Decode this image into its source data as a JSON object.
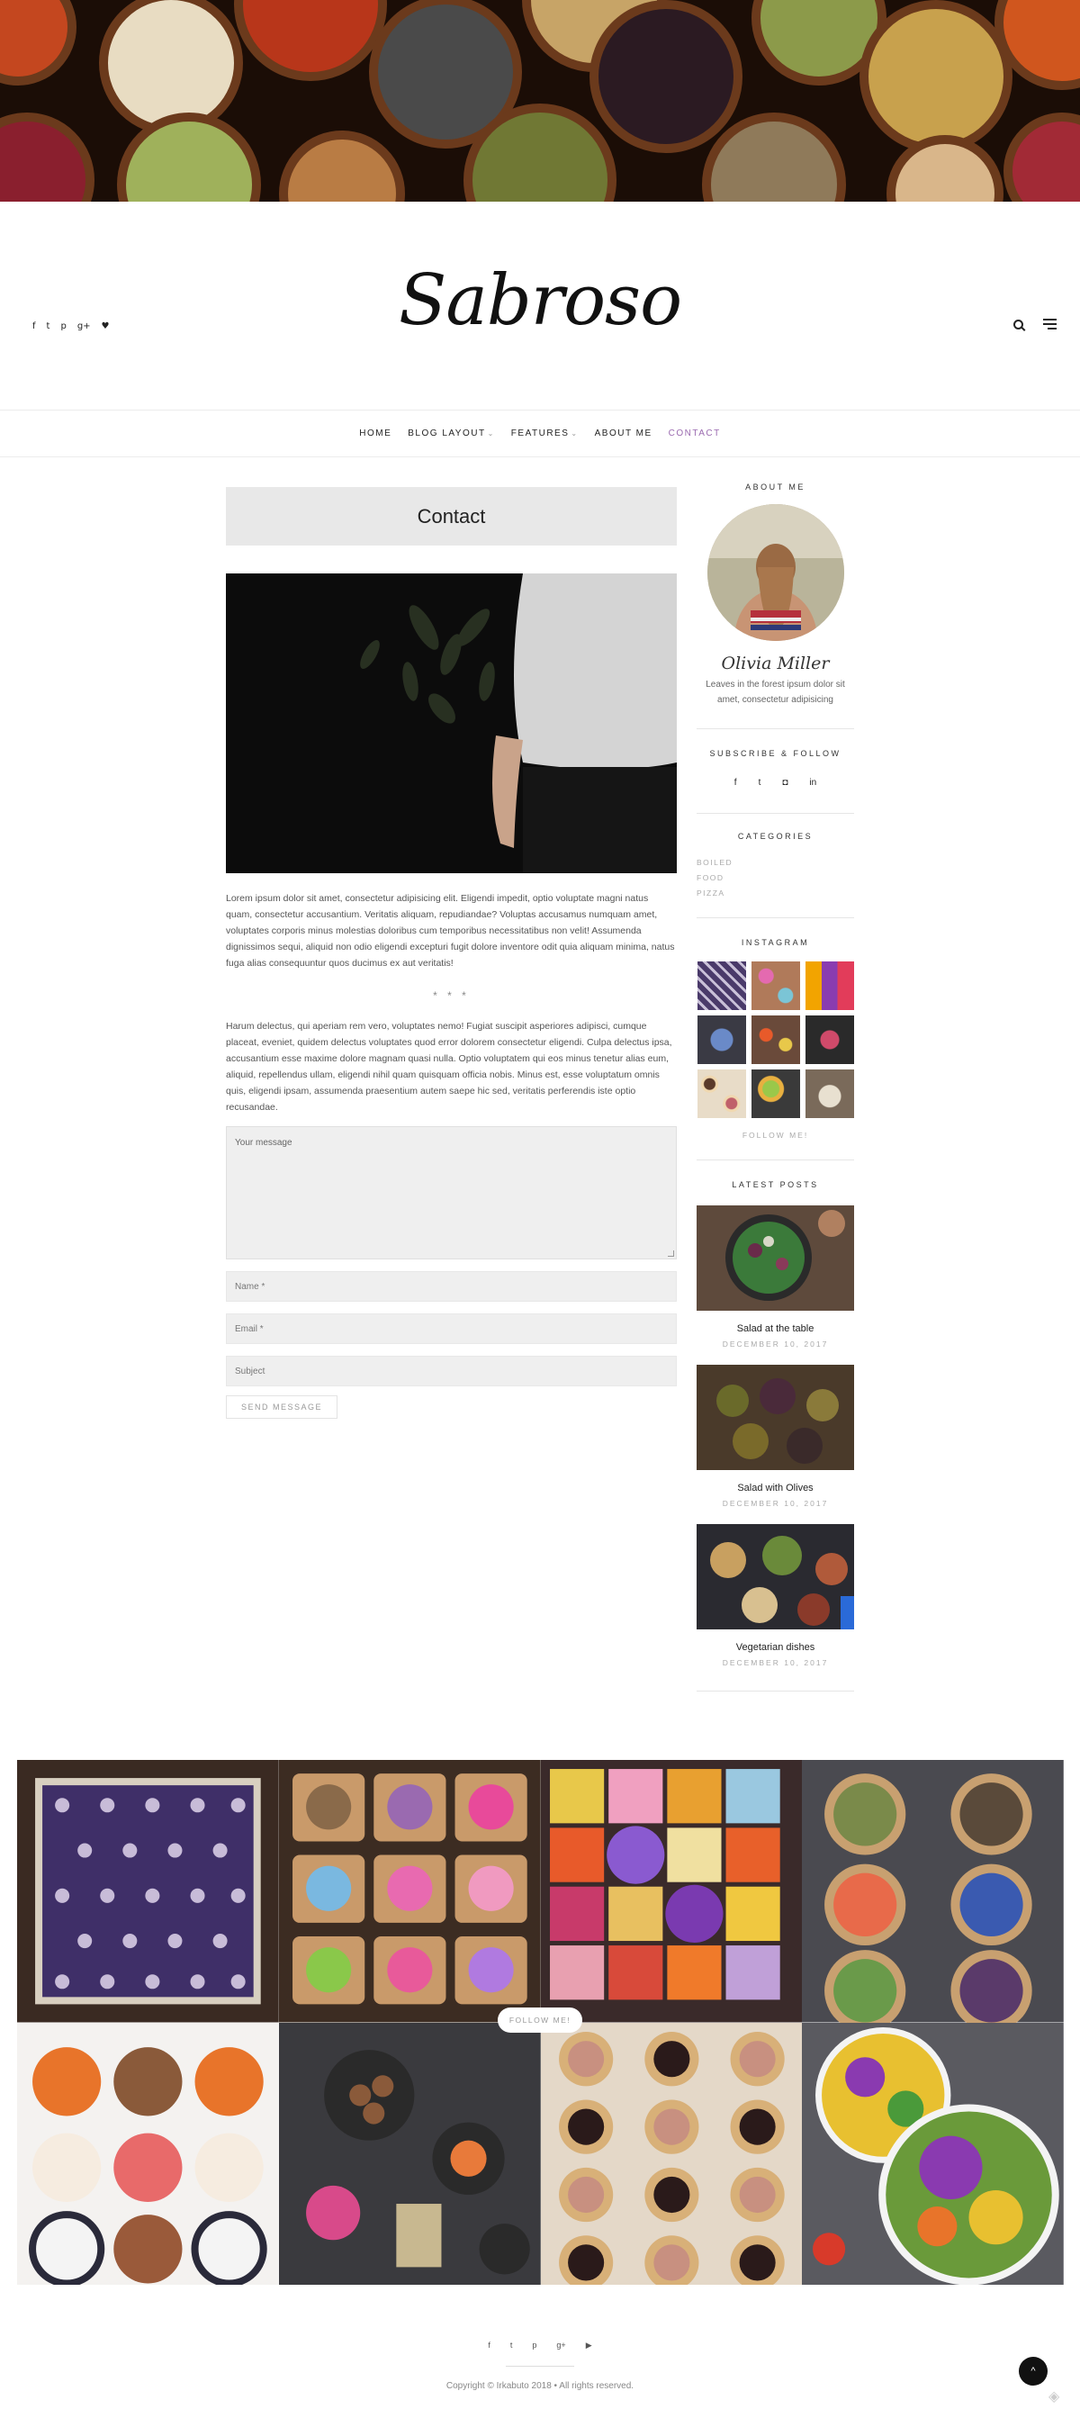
{
  "site": {
    "logo": "Sabroso"
  },
  "header": {
    "social": [
      "f",
      "t",
      "p",
      "g+",
      "♥"
    ],
    "search_icon": "search-icon",
    "menu_icon": "hamburger-icon"
  },
  "nav": {
    "items": [
      {
        "label": "HOME"
      },
      {
        "label": "BLOG LAYOUT",
        "dropdown": true
      },
      {
        "label": "FEATURES",
        "dropdown": true
      },
      {
        "label": "ABOUT ME"
      },
      {
        "label": "CONTACT",
        "active": true
      }
    ],
    "active_color": "#9b6bb0"
  },
  "main": {
    "title": "Contact",
    "para1": "Lorem ipsum dolor sit amet, consectetur adipisicing elit. Eligendi impedit, optio voluptate magni natus quam, consectetur accusantium. Veritatis aliquam, repudiandae? Voluptas accusamus numquam amet, voluptates corporis minus molestias doloribus cum temporibus necessitatibus non velit! Assumenda dignissimos sequi, aliquid non odio eligendi excepturi fugit dolore inventore odit quia aliquam minima, natus fuga alias consequuntur quos ducimus ex aut veritatis!",
    "separator": "* * *",
    "para2": "Harum delectus, qui aperiam rem vero, voluptates nemo! Fugiat suscipit asperiores adipisci, cumque placeat, eveniet, quidem delectus voluptates quod error dolorem consectetur eligendi. Culpa delectus ipsa, accusantium esse maxime dolore magnam quasi nulla. Optio voluptatem qui eos minus tenetur alias eum, aliquid, repellendus ullam, eligendi nihil quam quisquam officia nobis. Minus est, esse voluptatum omnis quis, eligendi ipsam, assumenda praesentium autem saepe hic sed, veritatis perferendis iste optio recusandae.",
    "form": {
      "message_placeholder": "Your message",
      "name_placeholder": "Name *",
      "email_placeholder": "Email *",
      "subject_placeholder": "Subject",
      "send_label": "SEND MESSAGE"
    }
  },
  "sidebar": {
    "about_title": "ABOUT ME",
    "author_name": "Olivia Miller",
    "author_bio": "Leaves in the forest ipsum dolor sit amet, consectetur adipisicing",
    "subscribe_title": "SUBSCRIBE & FOLLOW",
    "follow_icons": [
      "f",
      "t",
      "◘",
      "in"
    ],
    "categories_title": "CATEGORIES",
    "categories": [
      "BOILED",
      "FOOD",
      "PIZZA"
    ],
    "instagram_title": "INSTAGRAM",
    "instagram_follow": "FOLLOW ME!",
    "latest_title": "LATEST POSTS",
    "posts": [
      {
        "title": "Salad at the table",
        "date": "DECEMBER 10, 2017"
      },
      {
        "title": "Salad with Olives",
        "date": "DECEMBER 10, 2017"
      },
      {
        "title": "Vegetarian dishes",
        "date": "DECEMBER 10, 2017"
      }
    ]
  },
  "gallery": {
    "follow_label": "FOLLOW ME!"
  },
  "footer": {
    "social": [
      "f",
      "t",
      "p",
      "g+",
      "▶"
    ],
    "copyright": "Copyright © Irkabuto 2018 • All rights reserved.",
    "to_top": "^"
  }
}
